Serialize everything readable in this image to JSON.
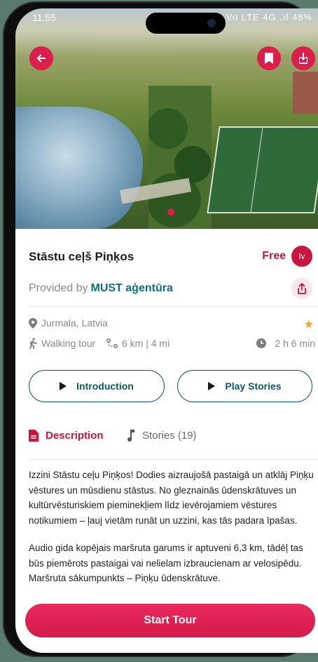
{
  "status_bar": {
    "time": "11:55",
    "icons_text": "🔔 ✈ ◉ Vo LTE 4G .ıl 48%"
  },
  "tour": {
    "title": "Stāstu ceļš Piņķos",
    "price": "Free",
    "language": "lv",
    "provided_by_label": "Provided by",
    "provider": "MUST aģentūra",
    "location": "Jurmala, Latvia",
    "tour_type": "Walking tour",
    "distance": "6 km | 4 mi",
    "duration": "2 h 6 min"
  },
  "actions": {
    "introduction_label": "Introduction",
    "play_stories_label": "Play Stories"
  },
  "tabs": {
    "description_label": "Description",
    "stories_label": "Stories (19)"
  },
  "description": {
    "paragraph_1": "Izzini Stāstu ceļu Piņķos! Dodies aizraujošā pastaigā un atklāj Piņķu vēstures un mūsdienu stāstus. No gleznainās ūdenskrātuves un kultūrvēsturiskiem pieminekļiem līdz ievērojamiem vēstures notikumiem – ļauj vietām runāt un uzzini, kas tās padara īpašas.",
    "paragraph_2": "Audio gida kopējais maršruta garums ir aptuveni 6,3 km, tādēļ tas būs piemērots pastaigai vai nelielam izbraucienam ar velosipēdu. Maršruta sākumpunkts – Piņķu ūdenskrātuve."
  },
  "footer": {
    "start_tour_label": "Start Tour"
  },
  "colors": {
    "accent": "#dc1e4b",
    "provider_link": "#0f6c7a",
    "outline": "#0f5866",
    "star": "#f0a030"
  },
  "icons": {
    "back": "arrow-left-icon",
    "bookmark": "bookmark-icon",
    "download": "download-icon",
    "share": "share-icon",
    "location": "map-pin-icon",
    "walking": "walking-person-icon",
    "route": "route-icon",
    "clock": "clock-icon",
    "star": "star-icon",
    "play": "play-icon",
    "document": "document-icon",
    "music": "music-note-icon"
  }
}
